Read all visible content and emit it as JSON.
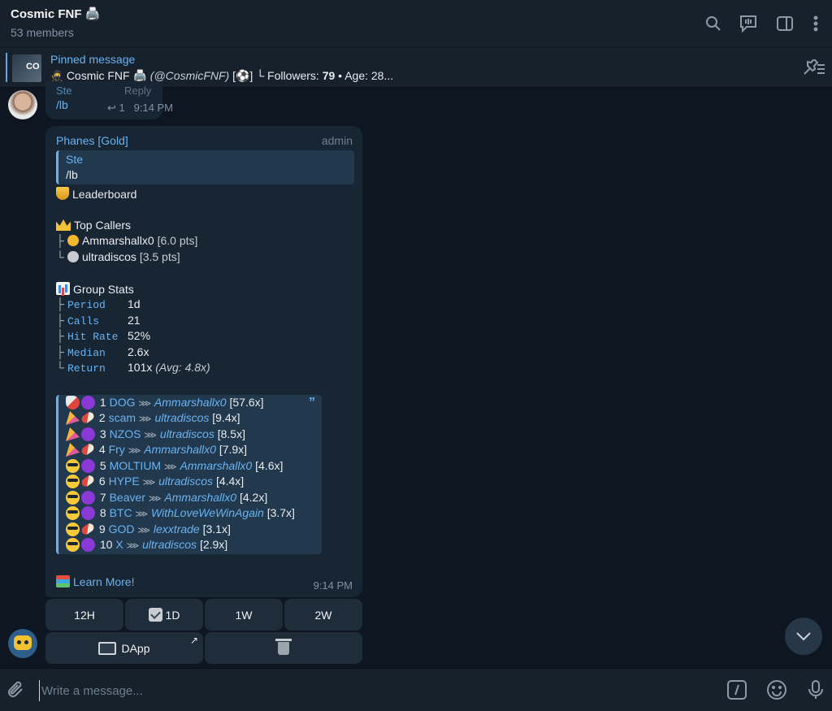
{
  "header": {
    "title": "Cosmic FNF 🖨️",
    "subtitle": "53 members"
  },
  "pinned": {
    "label": "Pinned message",
    "thumb_text": "CO",
    "text_name": "Cosmic FNF 🖨️",
    "text_handle": "(@CosmicFNF)",
    "text_badge": "[⚽]",
    "text_rest_prefix": "└ Followers: ",
    "followers": "79",
    "text_age": " • Age: 28..."
  },
  "prev_message": {
    "sender": "Ste",
    "reply_label": "Reply",
    "text": "/lb",
    "reply_count": "1",
    "time": "9:14 PM"
  },
  "message": {
    "sender": "Phanes [Gold]",
    "role": "admin",
    "quote": {
      "name": "Ste",
      "text": "/lb"
    },
    "leaderboard_title": "Leaderboard",
    "top_callers_title": "Top Callers",
    "callers": [
      {
        "tree": "├",
        "name": "Ammarshallx0",
        "pts": "[6.0 pts]",
        "medal": "gold"
      },
      {
        "tree": "└",
        "name": "ultradiscos",
        "pts": "[3.5 pts]",
        "medal": "silver"
      }
    ],
    "group_stats_title": "Group Stats",
    "stats": [
      {
        "tree": "├",
        "key": "Period",
        "value": "1d",
        "extra": ""
      },
      {
        "tree": "├",
        "key": "Calls",
        "value": "21",
        "extra": ""
      },
      {
        "tree": "├",
        "key": "Hit Rate",
        "value": "52%",
        "extra": ""
      },
      {
        "tree": "├",
        "key": "Median",
        "value": "2.6x",
        "extra": ""
      },
      {
        "tree": "└",
        "key": "Return",
        "value": "101x",
        "extra": "(Avg: 4.8x)"
      }
    ],
    "rows": [
      {
        "e1": "rocket",
        "e2": "purple",
        "rank": "1",
        "token": "DOG",
        "caller": "Ammarshallx0",
        "mult": "[57.6x]"
      },
      {
        "e1": "party",
        "e2": "pill",
        "rank": "2",
        "token": "scam",
        "caller": "ultradiscos",
        "mult": "[9.4x]"
      },
      {
        "e1": "party",
        "e2": "purple",
        "rank": "3",
        "token": "NZOS",
        "caller": "ultradiscos",
        "mult": "[8.5x]"
      },
      {
        "e1": "party",
        "e2": "pill",
        "rank": "4",
        "token": "Fry",
        "caller": "Ammarshallx0",
        "mult": "[7.9x]"
      },
      {
        "e1": "cool",
        "e2": "purple",
        "rank": "5",
        "token": "MOLTIUM",
        "caller": "Ammarshallx0",
        "mult": "[4.6x]"
      },
      {
        "e1": "cool",
        "e2": "pill",
        "rank": "6",
        "token": "HYPE",
        "caller": "ultradiscos",
        "mult": "[4.4x]"
      },
      {
        "e1": "cool",
        "e2": "purple",
        "rank": "7",
        "token": "Beaver",
        "caller": "Ammarshallx0",
        "mult": "[4.2x]"
      },
      {
        "e1": "cool",
        "e2": "purple",
        "rank": "8",
        "token": "BTC",
        "caller": "WithLoveWeWinAgain",
        "mult": "[3.7x]"
      },
      {
        "e1": "cool",
        "e2": "pill",
        "rank": "9",
        "token": "GOD",
        "caller": "lexxtrade",
        "mult": "[3.1x]"
      },
      {
        "e1": "cool",
        "e2": "purple",
        "rank": "10",
        "token": "X",
        "caller": "ultradiscos",
        "mult": "[2.9x]"
      }
    ],
    "learn_more": "Learn More!",
    "time": "9:14 PM"
  },
  "keyboard": {
    "row1": [
      "12H",
      "1D",
      "1W",
      "2W"
    ],
    "dapp": "DApp"
  },
  "composer": {
    "placeholder": "Write a message..."
  },
  "colors": {
    "background": "#0e1621",
    "bubble": "#182533",
    "accent": "#6ab3f3",
    "header": "#17212b"
  },
  "icons": [
    "search-icon",
    "video-chat-icon",
    "sidebar-icon",
    "more-icon",
    "unpin-icon",
    "attach-icon",
    "bot-command-icon",
    "emoji-icon",
    "microphone-icon",
    "chevron-down-icon"
  ]
}
